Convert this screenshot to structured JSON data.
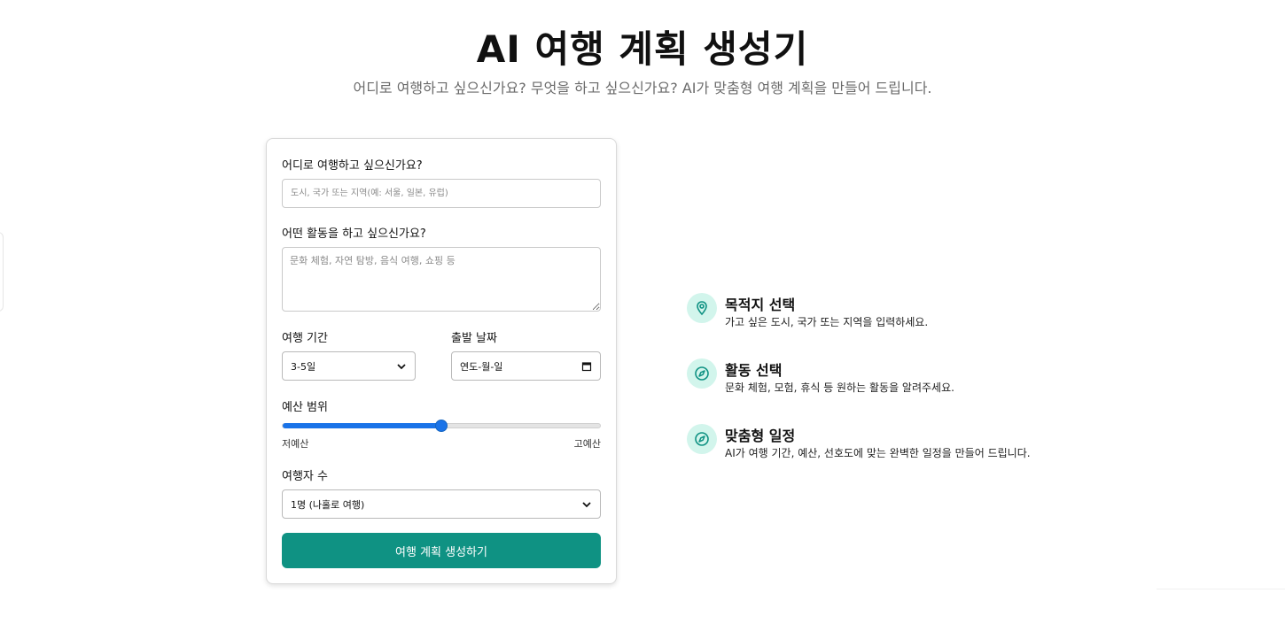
{
  "header": {
    "title": "AI 여행 계획 생성기",
    "subtitle": "어디로 여행하고 싶으신가요? 무엇을 하고 싶으신가요? AI가 맞춤형 여행 계획을 만들어 드립니다."
  },
  "form": {
    "destination": {
      "label": "어디로 여행하고 싶으신가요?",
      "placeholder": "도시, 국가 또는 지역(예: 서울, 일본, 유럽)",
      "value": ""
    },
    "activities": {
      "label": "어떤 활동을 하고 싶으신가요?",
      "placeholder": "문화 체험, 자연 탐방, 음식 여행, 쇼핑 등",
      "value": ""
    },
    "duration": {
      "label": "여행 기간",
      "selected": "3-5일"
    },
    "start_date": {
      "label": "출발 날짜",
      "value": "연도-월-일"
    },
    "budget": {
      "label": "예산 범위",
      "min_label": "저예산",
      "max_label": "고예산",
      "level": 0.5
    },
    "travelers": {
      "label": "여행자 수",
      "selected": "1명 (나홀로 여행)"
    },
    "submit_label": "여행 계획 생성하기"
  },
  "features": [
    {
      "icon": "location-pin-icon",
      "title": "목적지 선택",
      "description": "가고 싶은 도시, 국가 또는 지역을 입력하세요."
    },
    {
      "icon": "compass-icon",
      "title": "활동 선택",
      "description": "문화 체험, 모험, 휴식 등 원하는 활동을 알려주세요."
    },
    {
      "icon": "compass-icon",
      "title": "맞춤형 일정",
      "description": "AI가 여행 기간, 예산, 선호도에 맞는 완벽한 일정을 만들어 드립니다."
    }
  ],
  "colors": {
    "primary_button": "#0f9283",
    "slider_accent": "#1a73e8",
    "feature_icon_bg": "#d2f5ec",
    "feature_icon_fg": "#0f9283"
  }
}
